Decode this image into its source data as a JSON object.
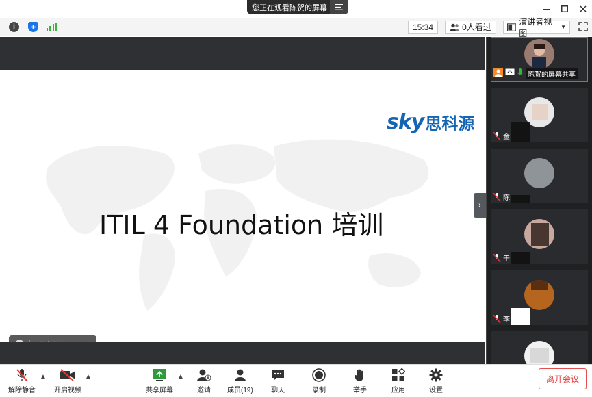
{
  "titlebar": {
    "viewing_text": "您正在观看陈贺的屏幕",
    "menu_icon": "list-icon"
  },
  "infobar": {
    "time": "15:34",
    "viewers": "0人看过",
    "view_mode": "演讲者视图"
  },
  "share": {
    "logo_sky": "sky",
    "logo_cn": "思科源",
    "slide_title": "ITIL 4 Foundation 培训",
    "chat_placeholder": "说点什么..."
  },
  "participants": [
    {
      "label": "陈贺的屏幕共享",
      "host": true
    },
    {
      "label": "金"
    },
    {
      "label": "陈"
    },
    {
      "label": "于"
    },
    {
      "label": "李"
    },
    {
      "label": ""
    }
  ],
  "toolbar": {
    "unmute": "解除静音",
    "video": "开启视频",
    "share": "共享屏幕",
    "invite": "邀请",
    "members": "成员(19)",
    "chat": "聊天",
    "record": "录制",
    "raise_hand": "举手",
    "apps": "应用",
    "settings": "设置",
    "leave": "离开会议"
  },
  "colors": {
    "accent": "#1565b5",
    "leave": "#e03b3b",
    "panel_bg": "#1f2022",
    "band_bg": "#2f3033"
  }
}
